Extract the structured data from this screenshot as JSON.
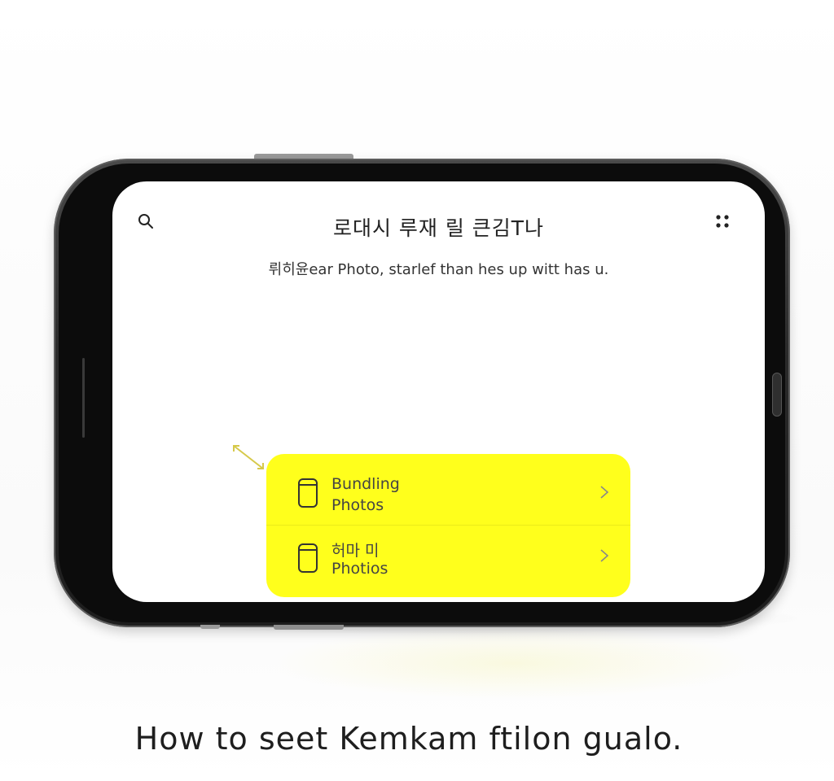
{
  "screen": {
    "title": "로대시 루재 릴 큰김T나",
    "subtitle": "뤼히윤ear Photo, starlef than hes up witt has u."
  },
  "icons": {
    "search": "search-icon",
    "menu": "four-dots-icon",
    "item": "cylinder-icon",
    "chevron": "chevron-right-icon",
    "pointer": "double-arrow-icon"
  },
  "list": {
    "items": [
      {
        "line1": "Bundling",
        "line2": "Photos"
      },
      {
        "line1": "허마 미",
        "line2": "Photios"
      }
    ]
  },
  "colors": {
    "accent": "#ffff1c",
    "arrow": "#d6c94a",
    "phone_frame": "#2b2b2b"
  },
  "caption": "How to seet  Kemkam ftilon  gualo."
}
